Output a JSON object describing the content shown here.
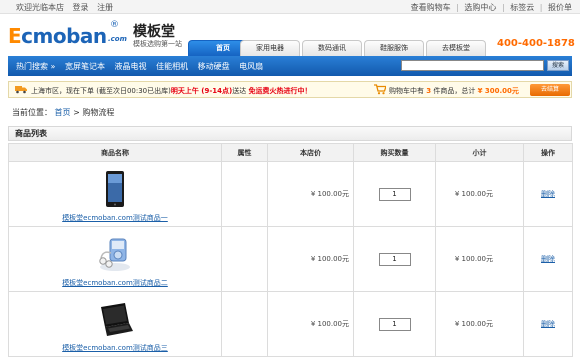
{
  "topbar": {
    "left": [
      "欢迎光临本店",
      "登录",
      "注册"
    ],
    "right": [
      "查看购物车",
      "选购中心",
      "标签云",
      "报价单"
    ]
  },
  "logo": {
    "brand": "Ecmoban",
    "com": ".com",
    "reg": "®",
    "cn": "模板堂",
    "sub": "模板选购第一站"
  },
  "nav": [
    "首页",
    "家用电器",
    "数码通讯",
    "鞋服服饰",
    "去模板堂"
  ],
  "hotline": "400-400-1878",
  "hot_search": {
    "label": "热门搜索 »",
    "items": [
      "宽屏笔记本",
      "液晶电视",
      "佳能相机",
      "移动硬盘",
      "电风扇"
    ],
    "button": "搜索"
  },
  "notice": {
    "prefix": "上海市区，现在下单 (截至次日00:30已出库)",
    "highlight": "明天上午 (9-14点)",
    "middle": "送达 ",
    "promo": "免运费火热进行中！"
  },
  "mini_cart": {
    "prefix": "购物车中有",
    "count": "3",
    "mid": "件商品，总计",
    "total": "¥ 300.00元",
    "checkout": "去结算"
  },
  "breadcrumb": {
    "label": "当前位置：",
    "home": "首页",
    "sep": ">",
    "current": "购物流程"
  },
  "section_title": "商品列表",
  "table": {
    "headers": [
      "商品名称",
      "属性",
      "本店价",
      "购买数量",
      "小计",
      "操作"
    ],
    "rows": [
      {
        "name": "模板堂ecmoban.com测试商品一",
        "attr": "",
        "price": "¥ 100.00元",
        "qty": "1",
        "subtotal": "¥ 100.00元",
        "action": "删除",
        "img": "tablet-icon"
      },
      {
        "name": "模板堂ecmoban.com测试商品二",
        "attr": "",
        "price": "¥ 100.00元",
        "qty": "1",
        "subtotal": "¥ 100.00元",
        "action": "删除",
        "img": "music-player-icon"
      },
      {
        "name": "模板堂ecmoban.com测试商品三",
        "attr": "",
        "price": "¥ 100.00元",
        "qty": "1",
        "subtotal": "¥ 100.00元",
        "action": "删除",
        "img": "laptop-icon"
      }
    ]
  },
  "colors": {
    "brand_blue": "#1c64b7",
    "accent_orange": "#ff6a00",
    "promo_red": "#e60012",
    "link": "#1b5fa8"
  }
}
